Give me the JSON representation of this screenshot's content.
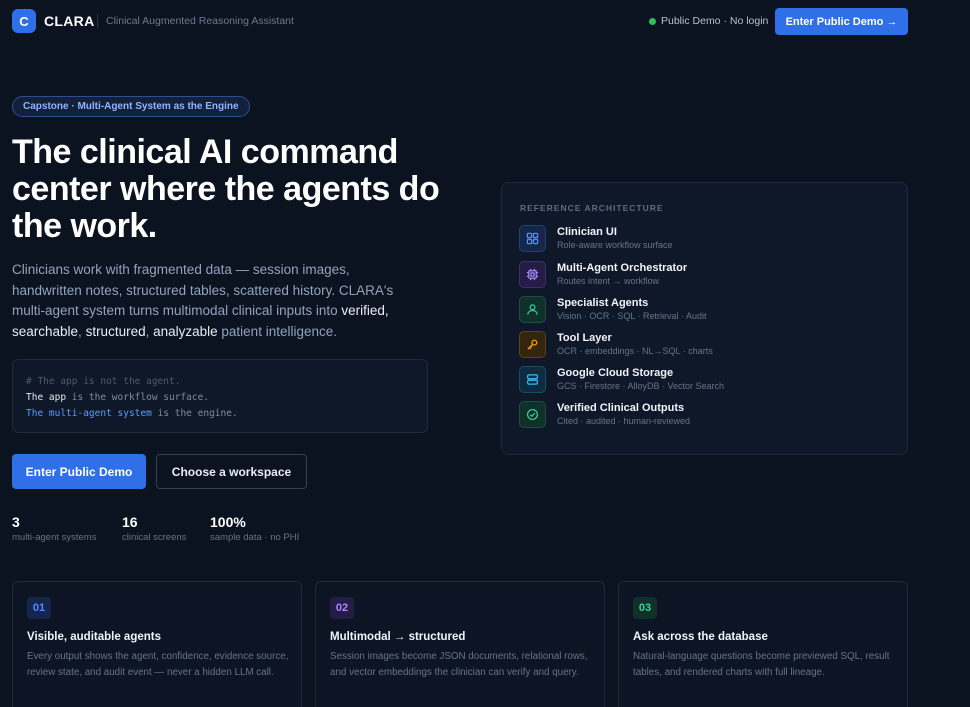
{
  "header": {
    "logo_letter": "C",
    "brand": "CLARA",
    "tagline": "Clinical Augmented Reasoning Assistant",
    "status": "Public Demo · No login",
    "cta": "Enter Public Demo →"
  },
  "hero": {
    "pill": "Capstone · Multi-Agent System as the Engine",
    "title_line1": "The clinical AI command",
    "title_line2": "center where the agents do",
    "title_line3": "the work.",
    "desc_part1": "Clinicians work with fragmented data — session images, handwritten notes, structured tables, scattered history. CLARA's multi-agent system turns multimodal clinical inputs into ",
    "desc_hl1": "verified,",
    "desc_hl2": "searchable",
    "desc_hl3": "structured",
    "desc_hl4": "analyzable",
    "desc_end": " patient intelligence.",
    "comma": ", ",
    "code_comment": "# The app is not the agent.",
    "code_line2_a": "The app",
    "code_line2_b": " is the workflow surface.",
    "code_line3_a": "The multi-agent system",
    "code_line3_b": " is the engine.",
    "btn_primary": "Enter Public Demo",
    "btn_secondary": "Choose a workspace",
    "stats": [
      {
        "value": "3",
        "label": "multi-agent systems"
      },
      {
        "value": "16",
        "label": "clinical screens"
      },
      {
        "value": "100%",
        "label": "sample data · no PHI"
      }
    ]
  },
  "architecture": {
    "title": "REFERENCE ARCHITECTURE",
    "layers": [
      {
        "name": "Clinician UI",
        "sub": "Role-aware workflow surface",
        "icon": "grid-icon",
        "color": "#4f8cff"
      },
      {
        "name": "Multi-Agent Orchestrator",
        "sub": "Routes intent → workflow",
        "icon": "cpu-icon",
        "color": "#a78bfa"
      },
      {
        "name": "Specialist Agents",
        "sub": "Vision · OCR · SQL · Retrieval · Audit",
        "icon": "user-icon",
        "color": "#34d399"
      },
      {
        "name": "Tool Layer",
        "sub": "OCR · embeddings · NL→SQL · charts",
        "icon": "key-icon",
        "color": "#f59e0b"
      },
      {
        "name": "Google Cloud Storage",
        "sub": "GCS · Firestore · AlloyDB · Vector Search",
        "icon": "database-icon",
        "color": "#38bdf8"
      },
      {
        "name": "Verified Clinical Outputs",
        "sub": "Cited · audited · human-reviewed",
        "icon": "check-circle-icon",
        "color": "#34d399"
      }
    ]
  },
  "features": [
    {
      "num": "01",
      "title": "Visible, auditable agents",
      "desc": "Every output shows the agent, confidence, evidence source, review state, and audit event — never a hidden LLM call.",
      "color": "#4f8cff"
    },
    {
      "num": "02",
      "title": "Multimodal → structured",
      "desc": "Session images become JSON documents, relational rows, and vector embeddings the clinician can verify and query.",
      "color": "#a78bfa"
    },
    {
      "num": "03",
      "title": "Ask across the database",
      "desc": "Natural-language questions become previewed SQL, result tables, and rendered charts with full lineage.",
      "color": "#34d399"
    }
  ]
}
